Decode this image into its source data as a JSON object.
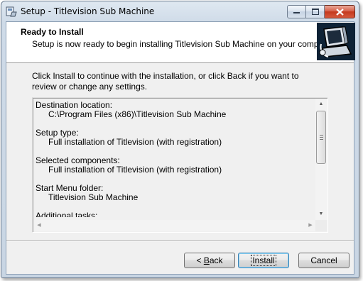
{
  "window": {
    "title": "Setup - Titlevision Sub Machine",
    "icon": "setup-app-icon"
  },
  "header": {
    "title": "Ready to Install",
    "subtitle": "Setup is now ready to begin installing Titlevision Sub Machine on your computer.",
    "logo": "installer-computer-logo"
  },
  "instruction": "Click Install to continue with the installation, or click Back if you want to review or change any settings.",
  "memo": {
    "sections": [
      {
        "label": "Destination location:",
        "value": "C:\\Program Files (x86)\\Titlevision Sub Machine"
      },
      {
        "label": "Setup type:",
        "value": "Full installation of Titlevision (with registration)"
      },
      {
        "label": "Selected components:",
        "value": "Full installation of Titlevision (with registration)"
      },
      {
        "label": "Start Menu folder:",
        "value": "Titlevision Sub Machine"
      },
      {
        "label": "Additional tasks:",
        "value": ""
      }
    ]
  },
  "buttons": {
    "back_prefix": "< ",
    "back_accel": "B",
    "back_rest": "ack",
    "install": "Install",
    "cancel": "Cancel"
  },
  "colors": {
    "accent": "#3c7fb1",
    "close_button": "#c4391d"
  }
}
